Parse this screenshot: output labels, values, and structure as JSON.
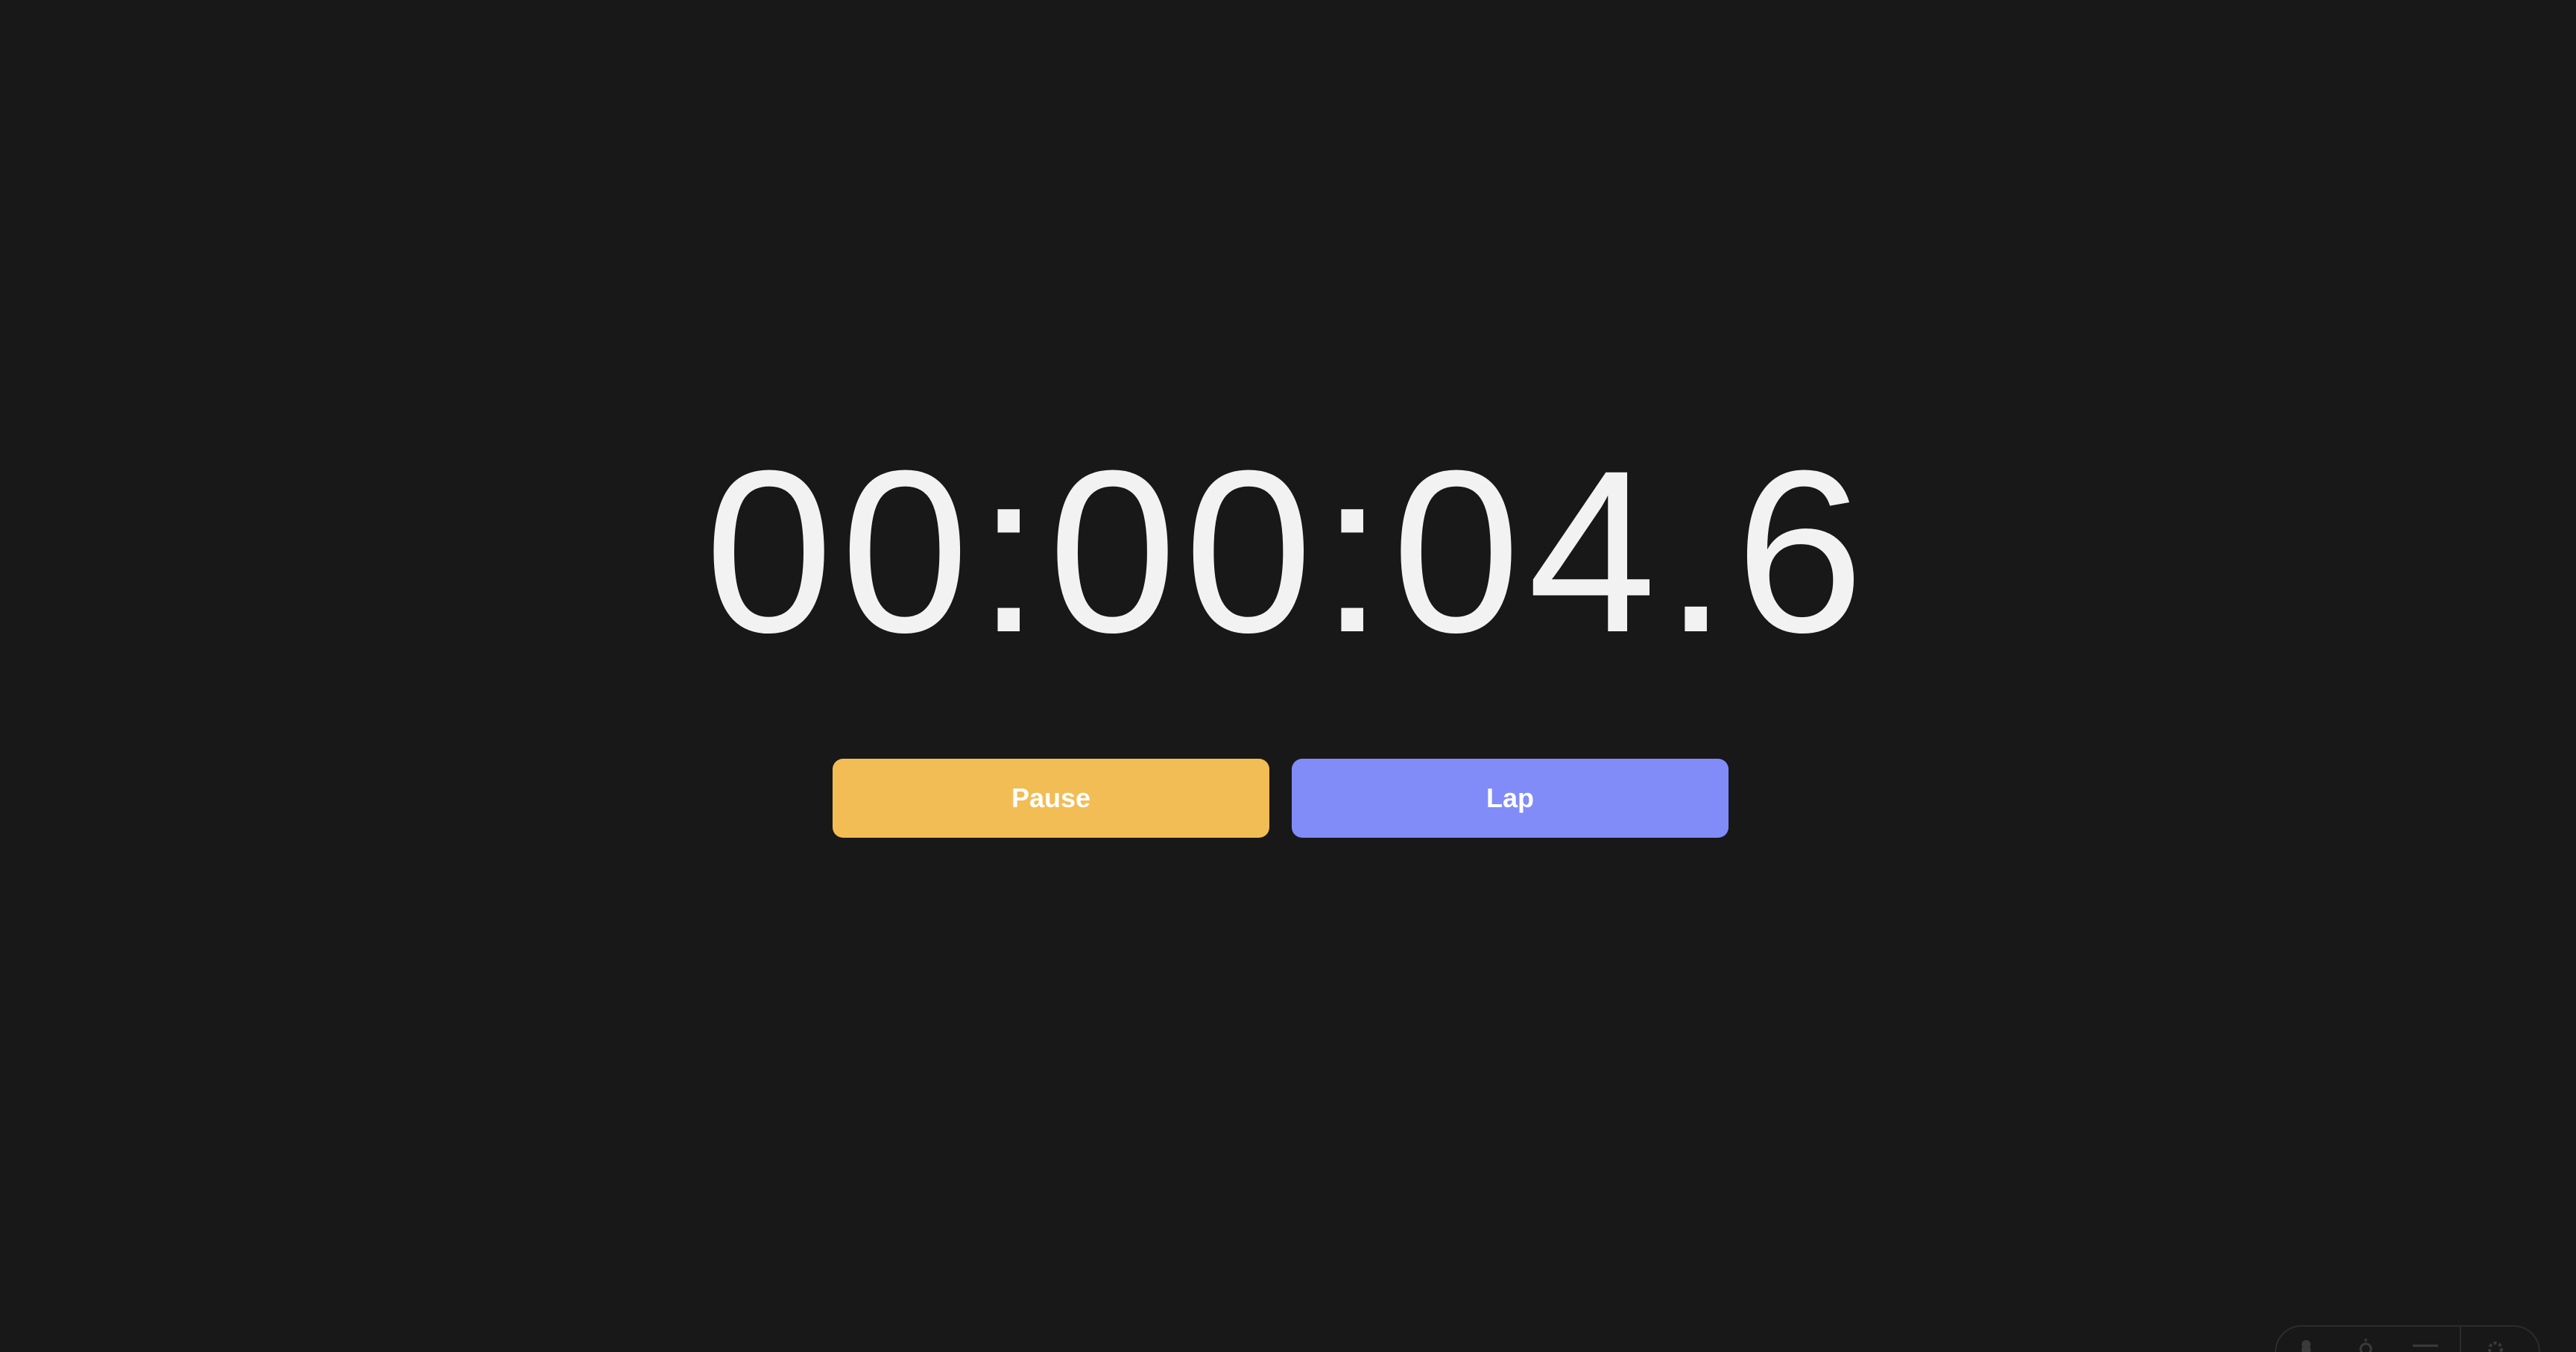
{
  "stopwatch": {
    "time": "00:00:04.6"
  },
  "controls": {
    "pause_label": "Pause",
    "lap_label": "Lap",
    "pause_color": "#f2bd54",
    "lap_color": "#818cf8"
  },
  "tray": {
    "icons": [
      "accessibility-icon",
      "theme-icon",
      "menu-icon",
      "settings-icon"
    ]
  },
  "colors": {
    "background": "#181818",
    "time_text": "#f2f2f2"
  }
}
